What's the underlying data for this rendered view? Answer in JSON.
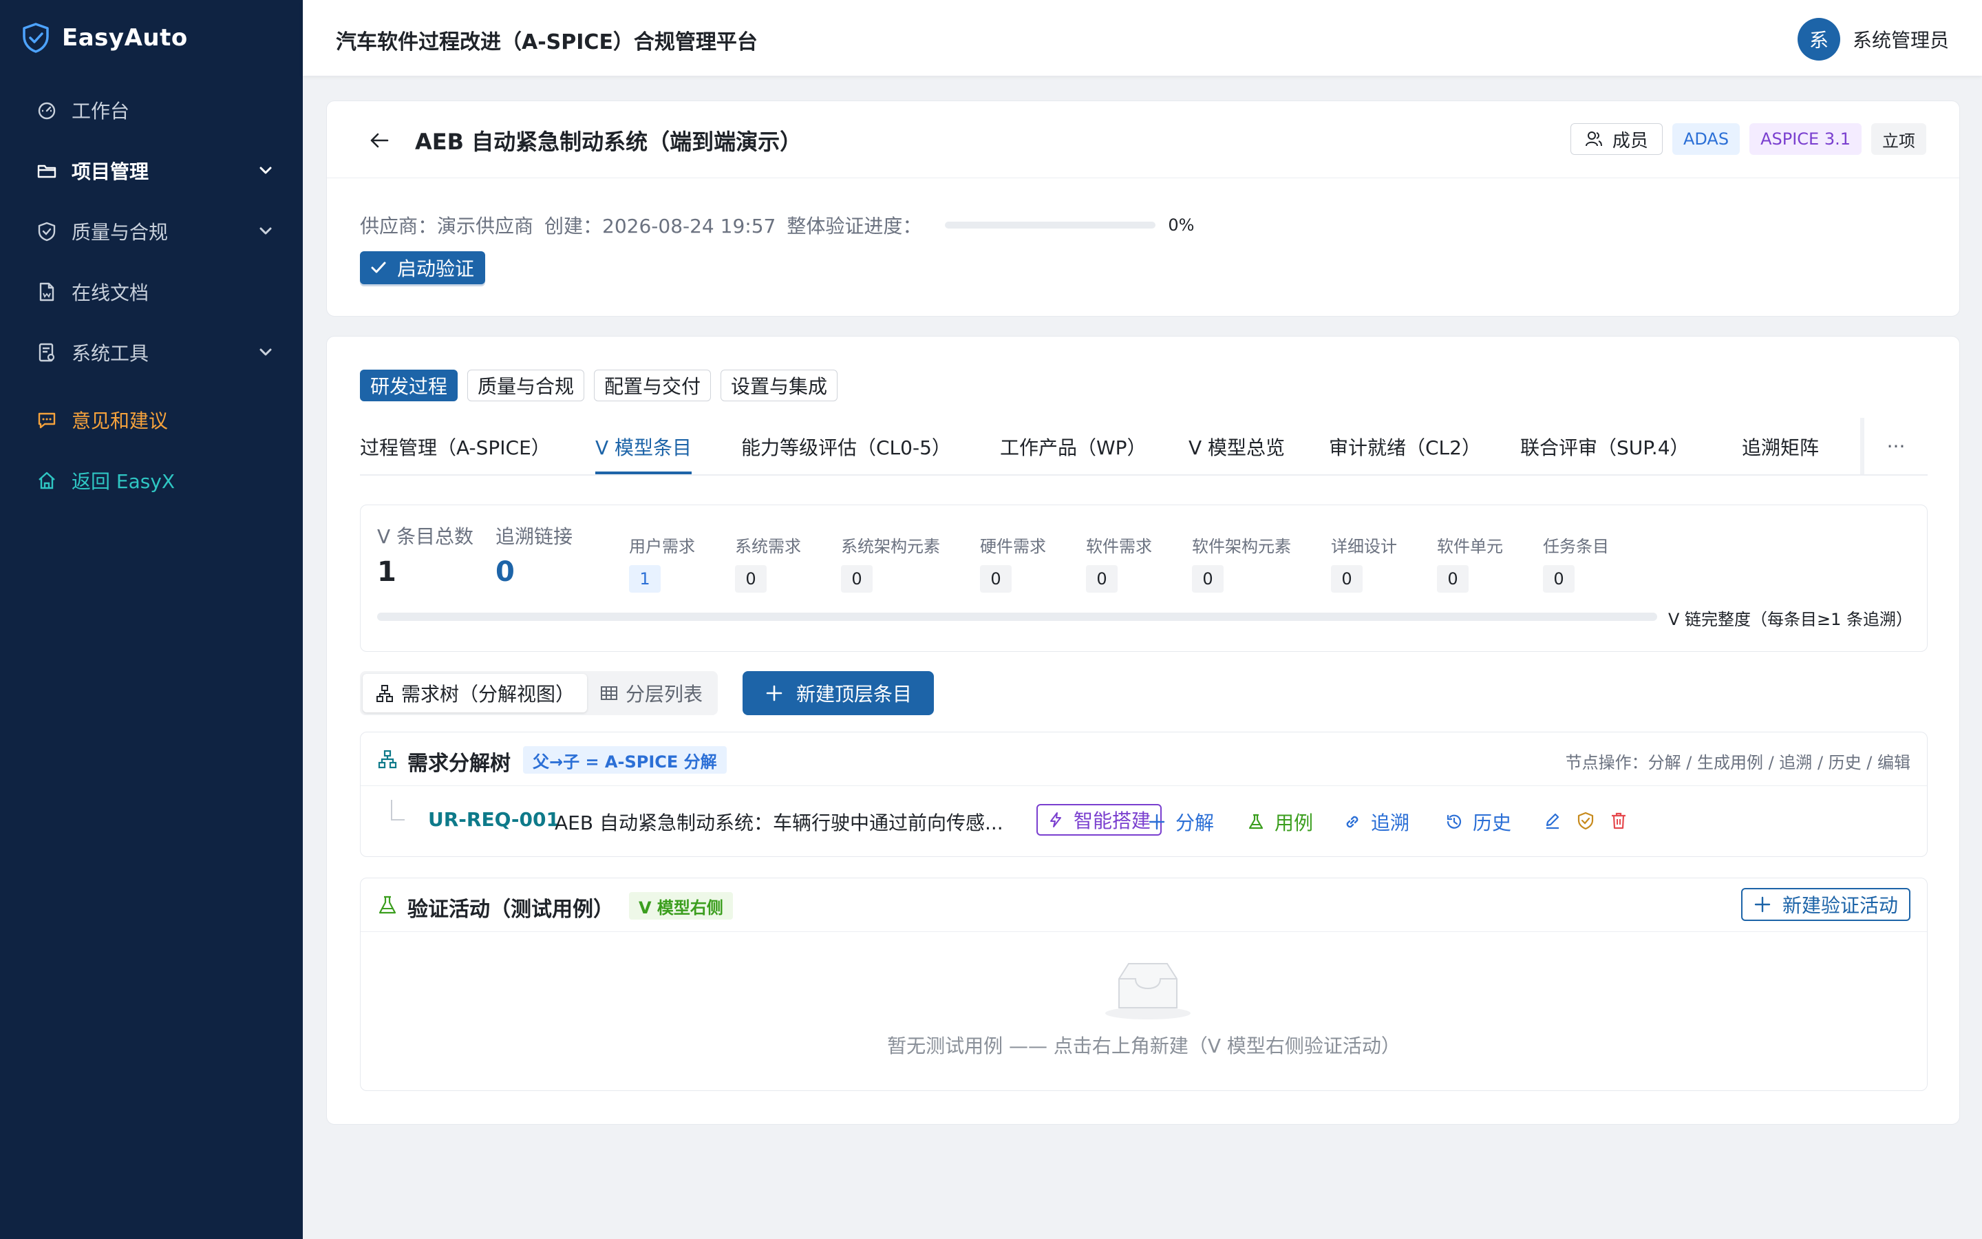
{
  "app": {
    "brand": "EasyAuto",
    "platform_title": "汽车软件过程改进（A-SPICE）合规管理平台",
    "user_avatar": "系",
    "user_name": "系统管理员",
    "colors": {
      "sidebar": "#0f2342",
      "primary": "#1d64a8",
      "feedback": "#f5a23c",
      "back_link": "#2fc6c3"
    }
  },
  "sidebar": {
    "items": [
      {
        "label": "工作台",
        "icon": "dashboard-icon"
      },
      {
        "label": "项目管理",
        "icon": "folder-icon",
        "expandable": true
      },
      {
        "label": "质量与合规",
        "icon": "shield-icon",
        "expandable": true
      },
      {
        "label": "在线文档",
        "icon": "document-icon"
      },
      {
        "label": "系统工具",
        "icon": "tools-icon",
        "expandable": true
      },
      {
        "label": "意见和建议",
        "icon": "chat-icon"
      },
      {
        "label": "返回 EasyX",
        "icon": "home-icon"
      }
    ]
  },
  "project": {
    "title": "AEB 自动紧急制动系统（端到端演示）",
    "members_label": "成员",
    "tags": [
      "ADAS",
      "ASPICE 3.1",
      "立项"
    ],
    "supplier": "供应商：演示供应商",
    "created": "创建：2026-08-24 19:57",
    "progress_label": "整体验证进度：",
    "progress_value": 0,
    "progress_text": "0%",
    "start_button": "启动验证"
  },
  "group_tabs": [
    "研发过程",
    "质量与合规",
    "配置与交付",
    "设置与集成"
  ],
  "group_tab_active": "研发过程",
  "sub_tabs": [
    "过程管理（A-SPICE）",
    "V 模型条目",
    "能力等级评估（CL0-5）",
    "工作产品（WP）",
    "V 模型总览",
    "审计就绪（CL2）",
    "联合评审（SUP.4）",
    "追溯矩阵"
  ],
  "sub_tab_active": "V 模型条目",
  "more_label": "···",
  "stats": {
    "total_label": "V 条目总数",
    "total_value": "1",
    "links_label": "追溯链接",
    "links_value": "0",
    "categories": [
      {
        "label": "用户需求",
        "value": "1"
      },
      {
        "label": "系统需求",
        "value": "0"
      },
      {
        "label": "系统架构元素",
        "value": "0"
      },
      {
        "label": "硬件需求",
        "value": "0"
      },
      {
        "label": "软件需求",
        "value": "0"
      },
      {
        "label": "软件架构元素",
        "value": "0"
      },
      {
        "label": "详细设计",
        "value": "0"
      },
      {
        "label": "软件单元",
        "value": "0"
      },
      {
        "label": "任务条目",
        "value": "0"
      }
    ],
    "chain_label": "V 链完整度（每条目≥1 条追溯）",
    "chain_value": 0
  },
  "views": {
    "tree_label": "需求树（分解视图）",
    "list_label": "分层列表",
    "new_top_button": "新建顶层条目"
  },
  "tree_panel": {
    "title": "需求分解树",
    "tag": "父→子 = A-SPICE 分解",
    "node_ops": "节点操作：分解 / 生成用例 / 追溯 / 历史 / 编辑",
    "row": {
      "id": "UR-REQ-001",
      "text": "AEB 自动紧急制动系统：车辆行驶中通过前向传感...",
      "smart_build": "智能搭建",
      "decompose": "分解",
      "use_case": "用例",
      "trace": "追溯",
      "history": "历史"
    }
  },
  "verify_panel": {
    "title": "验证活动（测试用例）",
    "tag": "V 模型右侧",
    "new_button": "新建验证活动",
    "empty_text": "暂无测试用例 —— 点击右上角新建（V 模型右侧验证活动）"
  }
}
